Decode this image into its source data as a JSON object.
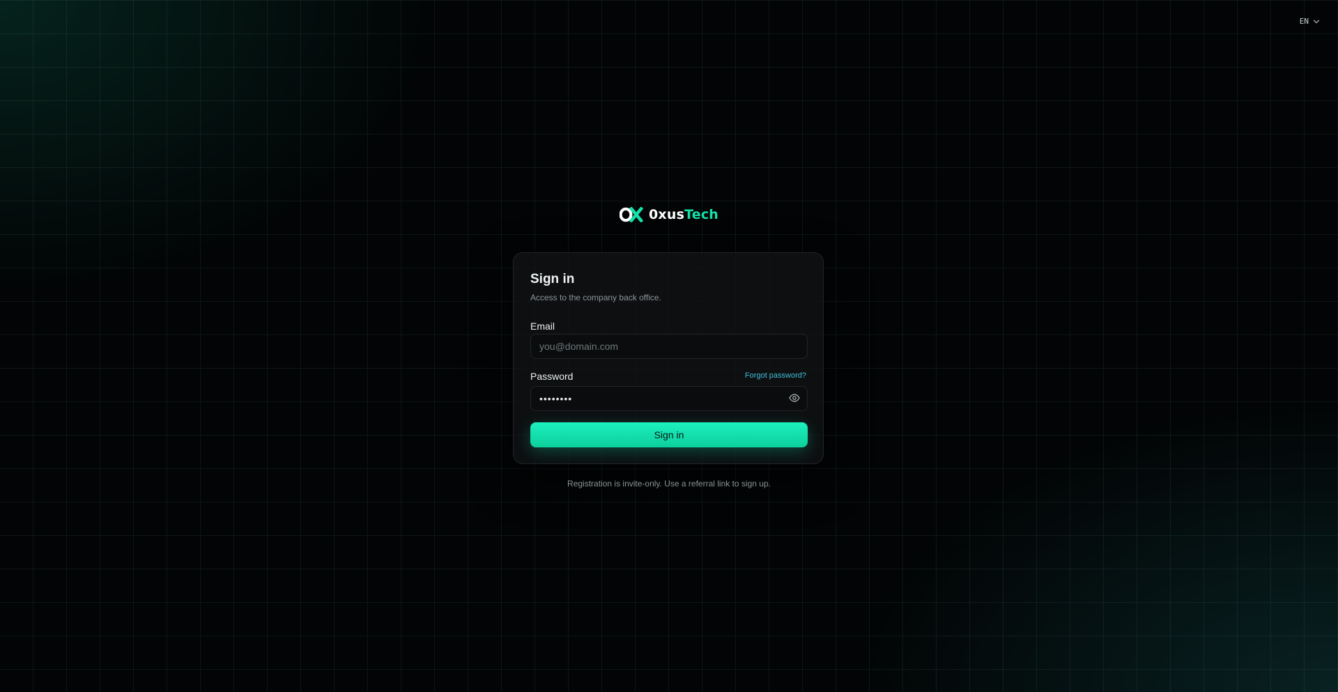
{
  "language_selector": {
    "value": "EN",
    "icon": "chevron-down-icon"
  },
  "brand": {
    "logo_mark": "OX",
    "name_part1": "0xus",
    "name_part2": "Tech",
    "accent_color": "#16e0a8"
  },
  "signin_card": {
    "title": "Sign in",
    "subtitle": "Access to the company back office.",
    "email": {
      "label": "Email",
      "placeholder": "you@domain.com",
      "value": ""
    },
    "password": {
      "label": "Password",
      "value": "••••••••",
      "forgot_label": "Forgot password?",
      "toggle_icon": "eye-icon"
    },
    "submit_label": "Sign in"
  },
  "footer_note": "Registration is invite-only. Use a referral link to sign up."
}
